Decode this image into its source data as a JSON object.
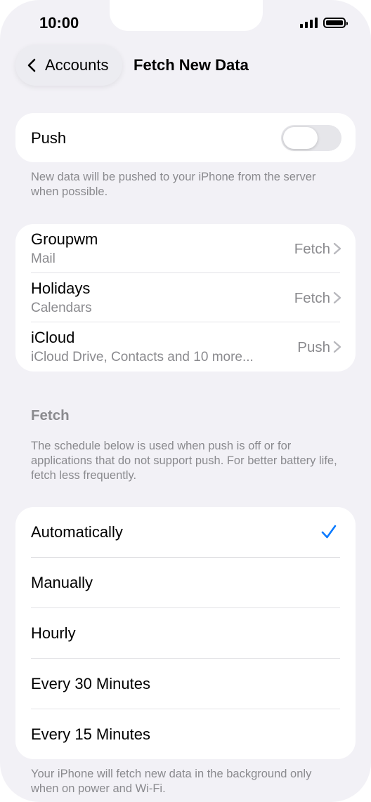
{
  "status_bar": {
    "time": "10:00"
  },
  "nav": {
    "back_label": "Accounts",
    "title": "Fetch New Data"
  },
  "push": {
    "label": "Push",
    "enabled": false,
    "footnote": "New data will be pushed to your iPhone from the server when possible."
  },
  "accounts": [
    {
      "name": "Groupwm",
      "subtitle": "Mail",
      "value": "Fetch"
    },
    {
      "name": "Holidays",
      "subtitle": "Calendars",
      "value": "Fetch"
    },
    {
      "name": "iCloud",
      "subtitle": "iCloud Drive, Contacts and 10 more...",
      "value": "Push"
    }
  ],
  "fetch": {
    "header": "Fetch",
    "description": "The schedule below is used when push is off or for applications that do not support push. For better battery life, fetch less frequently.",
    "options": [
      "Automatically",
      "Manually",
      "Hourly",
      "Every 30 Minutes",
      "Every 15 Minutes"
    ],
    "selected": "Automatically",
    "footnote": "Your iPhone will fetch new data in the background only when on power and Wi-Fi."
  },
  "colors": {
    "accent": "#0a7aff",
    "background": "#f2f1f6",
    "secondary_text": "#8a8a8e"
  }
}
